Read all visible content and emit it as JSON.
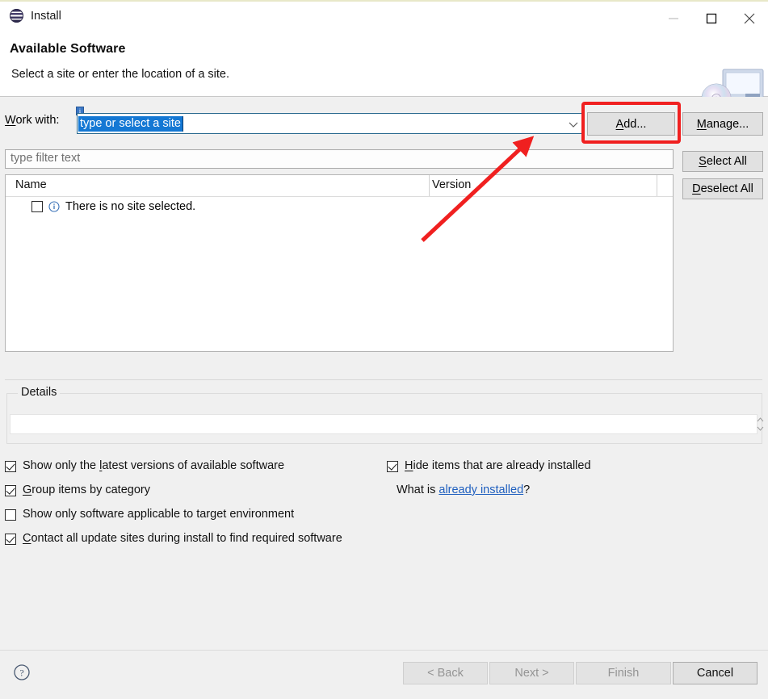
{
  "window": {
    "title": "Install",
    "icon": "eclipse-icon",
    "controls": {
      "minimize": "minimize-icon",
      "maximize": "maximize-icon",
      "close": "close-icon"
    }
  },
  "header": {
    "title": "Available Software",
    "subtitle": "Select a site or enter the location of a site.",
    "banner_icon": "install-monitor-cd-icon"
  },
  "work_with": {
    "label_pre": "W",
    "label_post": "ork with:",
    "value": "type or select a site",
    "assist_badge": "content-assist-icon",
    "dropdown_icon": "chevron-down-icon"
  },
  "filter": {
    "placeholder": "type filter text",
    "value": ""
  },
  "table": {
    "columns": [
      "Name",
      "Version"
    ],
    "rows": [
      {
        "checked": false,
        "icon": "info-icon",
        "name": "There is no site selected.",
        "version": ""
      }
    ]
  },
  "side_buttons": [
    {
      "id": "add",
      "mnemonic": "A",
      "rest": "dd...",
      "enabled": true,
      "highlighted": true
    },
    {
      "id": "manage",
      "mnemonic": "M",
      "rest": "anage...",
      "enabled": true,
      "highlighted": false
    },
    {
      "id": "select-all",
      "mnemonic": "S",
      "rest": "elect All",
      "enabled": true,
      "highlighted": false
    },
    {
      "id": "deselect-all",
      "mnemonic": "D",
      "rest": "eselect All",
      "enabled": true,
      "highlighted": false
    }
  ],
  "details": {
    "legend": "Details",
    "value": ""
  },
  "options": [
    {
      "id": "latest-versions",
      "checked": true,
      "pre": "Show only the ",
      "mnemonic": "l",
      "post": "atest versions of available software"
    },
    {
      "id": "group-by-category",
      "checked": true,
      "pre": "",
      "mnemonic": "G",
      "post": "roup items by category"
    },
    {
      "id": "target-environment",
      "checked": false,
      "pre": "",
      "mnemonic": "",
      "post": "Show only software applicable to target environment"
    },
    {
      "id": "contact-update-sites",
      "checked": true,
      "pre": "",
      "mnemonic": "C",
      "post": "ontact all update sites during install to find required software"
    },
    {
      "id": "hide-installed",
      "checked": true,
      "pre": "",
      "mnemonic": "H",
      "post": "ide items that are already installed"
    }
  ],
  "what_is": {
    "prefix": "What is ",
    "link": "already installed",
    "suffix": "?"
  },
  "footer": {
    "help_icon": "help-question-icon",
    "buttons": [
      {
        "id": "back",
        "label": "< Back",
        "enabled": false
      },
      {
        "id": "next",
        "label": "Next >",
        "enabled": false
      },
      {
        "id": "finish",
        "label": "Finish",
        "enabled": false
      },
      {
        "id": "cancel",
        "label": "Cancel",
        "enabled": true
      }
    ]
  },
  "annotation": {
    "highlight_color": "#f02020",
    "target": "add-button",
    "shape": "rectangle-and-arrow"
  }
}
